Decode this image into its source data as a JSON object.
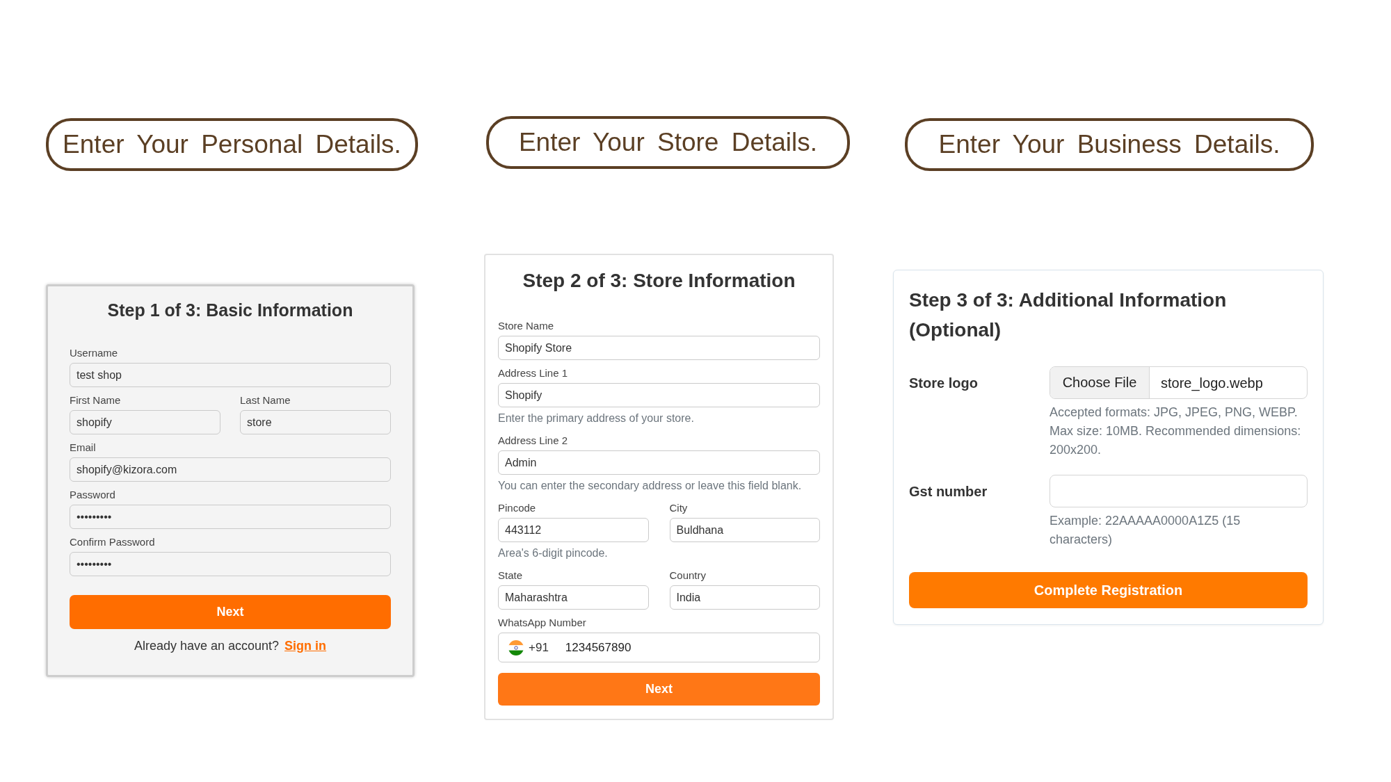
{
  "steps": [
    {
      "banner": "Enter Your Personal Details.",
      "form": {
        "kind": "stacked",
        "title": "Step 1 of 3: Basic Information",
        "rows": [
          [
            {
              "kind": "text",
              "label": "Username",
              "value": "test shop"
            }
          ],
          [
            {
              "kind": "text",
              "label": "First Name",
              "value": "shopify"
            },
            {
              "kind": "text",
              "label": "Last Name",
              "value": "store"
            }
          ],
          [
            {
              "kind": "text",
              "label": "Email",
              "value": "shopify@kizora.com"
            }
          ],
          [
            {
              "kind": "text",
              "label": "Password",
              "value": "•••••••••"
            }
          ],
          [
            {
              "kind": "text",
              "label": "Confirm Password",
              "value": "•••••••••"
            }
          ]
        ],
        "button": "Next",
        "footer": {
          "text": "Already have an account?",
          "link": "Sign in"
        }
      }
    },
    {
      "banner": "Enter Your Store Details.",
      "form": {
        "kind": "stacked",
        "title": "Step 2 of 3: Store Information",
        "rows": [
          [
            {
              "kind": "text",
              "label": "Store Name",
              "value": "Shopify Store"
            }
          ],
          [
            {
              "kind": "text",
              "label": "Address Line 1",
              "value": "Shopify",
              "help": "Enter the primary address of your store."
            }
          ],
          [
            {
              "kind": "text",
              "label": "Address Line 2",
              "value": "Admin",
              "help": "You can enter the secondary address or leave this field blank."
            }
          ],
          [
            {
              "kind": "text",
              "label": "Pincode",
              "value": "443112",
              "help": "Area's 6-digit pincode."
            },
            {
              "kind": "text",
              "label": "City",
              "value": "Buldhana"
            }
          ],
          [
            {
              "kind": "text",
              "label": "State",
              "value": "Maharashtra"
            },
            {
              "kind": "text",
              "label": "Country",
              "value": "India"
            }
          ],
          [
            {
              "kind": "phone",
              "label": "WhatsApp Number",
              "country_code": "+91",
              "value": "1234567890"
            }
          ]
        ],
        "button": "Next"
      }
    },
    {
      "banner": "Enter Your Business Details.",
      "form": {
        "kind": "side_labels",
        "title": "Step 3 of 3: Additional Information (Optional)",
        "rows": [
          [
            {
              "kind": "file",
              "label": "Store logo",
              "button": "Choose File",
              "file_name": "store_logo.webp",
              "help": "Accepted formats: JPG, JPEG, PNG, WEBP. Max size: 10MB. Recommended dimensions: 200x200."
            }
          ],
          [
            {
              "kind": "text",
              "label": "Gst number",
              "help": "Example: 22AAAAA0000A1Z5 (15 characters)"
            }
          ]
        ],
        "button": "Complete Registration"
      }
    }
  ]
}
